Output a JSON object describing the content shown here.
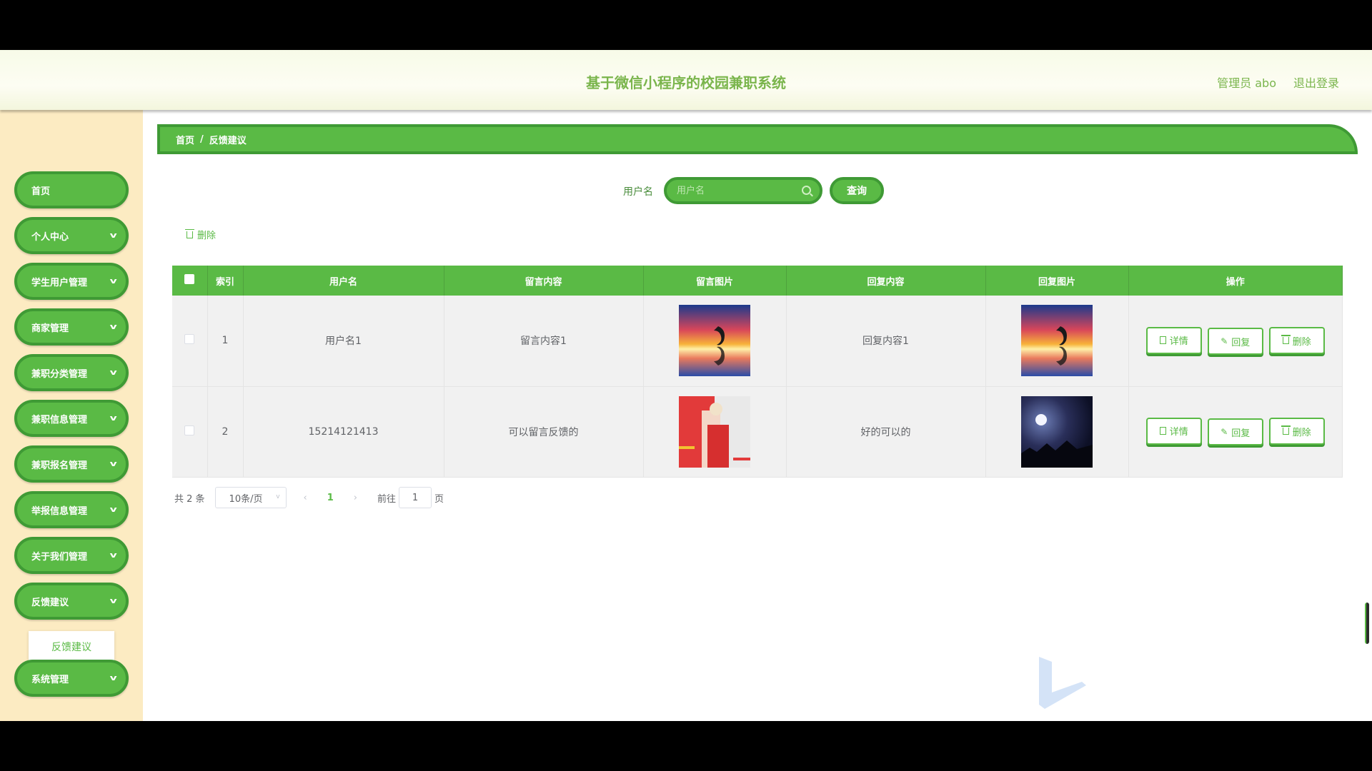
{
  "header": {
    "title": "基于微信小程序的校园兼职系统",
    "user": "管理员 abo",
    "logout": "退出登录"
  },
  "sidebar": {
    "items": [
      {
        "label": "首页",
        "has_arrow": false
      },
      {
        "label": "个人中心",
        "has_arrow": true
      },
      {
        "label": "学生用户管理",
        "has_arrow": true
      },
      {
        "label": "商家管理",
        "has_arrow": true
      },
      {
        "label": "兼职分类管理",
        "has_arrow": true
      },
      {
        "label": "兼职信息管理",
        "has_arrow": true
      },
      {
        "label": "兼职报名管理",
        "has_arrow": true
      },
      {
        "label": "举报信息管理",
        "has_arrow": true
      },
      {
        "label": "关于我们管理",
        "has_arrow": true
      },
      {
        "label": "反馈建议",
        "has_arrow": true
      },
      {
        "label": "系统管理",
        "has_arrow": true
      }
    ],
    "submenu": "反馈建议"
  },
  "breadcrumb": {
    "home": "首页",
    "sep": "/",
    "current": "反馈建议"
  },
  "search": {
    "label": "用户名",
    "placeholder": "用户名",
    "button": "查询"
  },
  "toolbar": {
    "delete": "删除"
  },
  "table": {
    "headers": [
      "",
      "索引",
      "用户名",
      "留言内容",
      "留言图片",
      "回复内容",
      "回复图片",
      "操作"
    ],
    "rows": [
      {
        "index": "1",
        "username": "用户名1",
        "message": "留言内容1",
        "reply": "回复内容1",
        "msg_img": "sunset-dolphin-image",
        "reply_img": "sunset-dolphin-image"
      },
      {
        "index": "2",
        "username": "15214121413",
        "message": "可以留言反馈的",
        "reply": "好的可以的",
        "msg_img": "poster-woman-image",
        "reply_img": "night-moon-image"
      }
    ],
    "actions": {
      "detail": "详情",
      "reply": "回复",
      "delete": "删除"
    }
  },
  "pagination": {
    "total": "共 2 条",
    "page_size": "10条/页",
    "current": "1",
    "goto_prefix": "前往",
    "goto_value": "1",
    "goto_suffix": "页"
  },
  "colors": {
    "accent": "#5aba45",
    "accent_dark": "#3f9a35",
    "sidebar_bg": "#fcebc2"
  }
}
